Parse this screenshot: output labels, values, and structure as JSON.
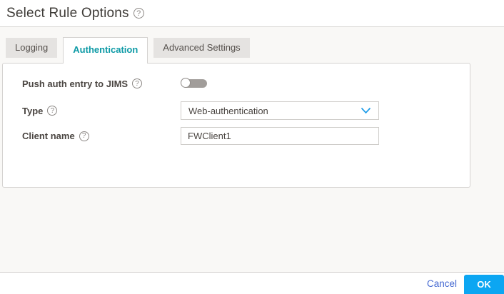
{
  "page": {
    "title": "Select Rule Options"
  },
  "icons": {
    "help_glyph": "?"
  },
  "tabs": [
    {
      "label": "Logging",
      "active": false
    },
    {
      "label": "Authentication",
      "active": true
    },
    {
      "label": "Advanced Settings",
      "active": false
    }
  ],
  "form": {
    "fields": [
      {
        "label": "Push auth entry to JIMS",
        "control": "toggle",
        "state": "off"
      },
      {
        "label": "Type",
        "control": "dropdown",
        "value": "Web-authentication"
      },
      {
        "label": "Client name",
        "control": "text-input",
        "value": "FWClient1"
      }
    ]
  },
  "footer": {
    "cancel_label": "Cancel",
    "ok_label": "OK"
  },
  "colors": {
    "active_tab_text": "#0d9aa6",
    "ok_button_bg": "#0ca6f2",
    "cancel_link": "#4468d1",
    "dropdown_chevron": "#1d9ce9",
    "toggle_off_track": "#a19d9a",
    "body_background": "#f9f8f6"
  }
}
